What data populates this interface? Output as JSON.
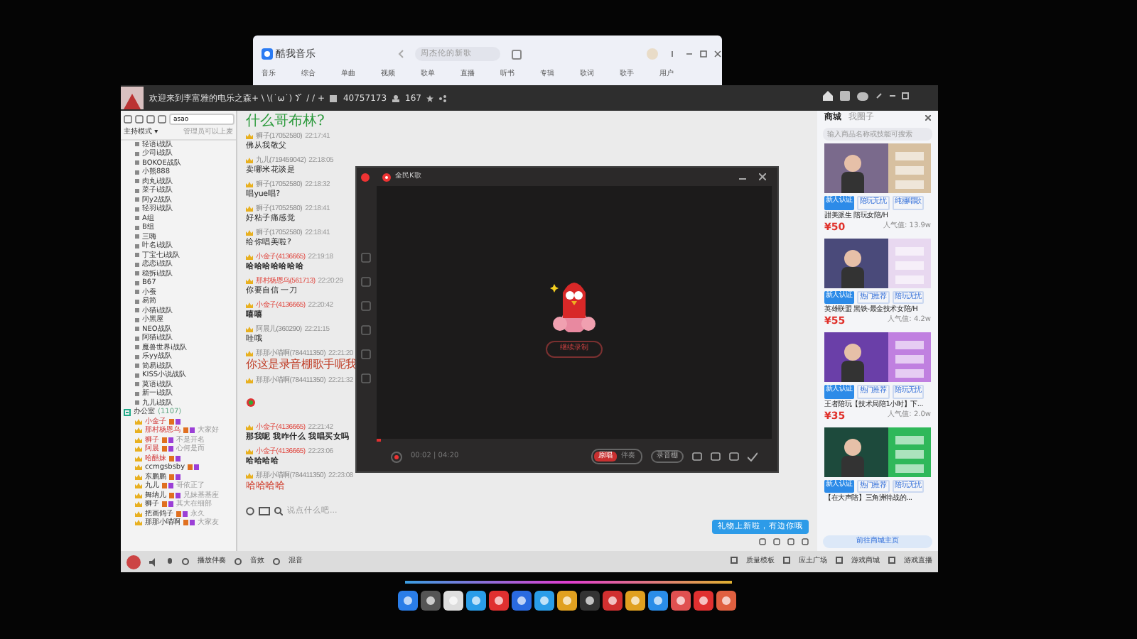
{
  "music_window": {
    "app_name": "酷我音乐",
    "search_placeholder": "周杰伦的新歌",
    "nav_item": "音乐",
    "tabs": [
      "综合",
      "单曲",
      "视频",
      "歌单",
      "直播",
      "听书",
      "专辑",
      "歌词",
      "歌手",
      "用户"
    ]
  },
  "room_window": {
    "title": "欢迎来到李富雅的电乐之森+ \\ \\(˙ω˙)",
    "title_end": "/ / +",
    "room_id": "40757173",
    "online": "167",
    "left_panel": {
      "search_value": "asao",
      "mode": "主持模式 ▾",
      "mode_hint": "管理员可以上麦",
      "channels": [
        "轻语i战队",
        "少司i战队",
        "BOKOE战队",
        "小熊888",
        "肉丸i战队",
        "菜子i战队",
        "阿y2战队",
        "轻羽i战队",
        "A组",
        "B组",
        "三嗨",
        "叶名i战队",
        "丁宝七i战队",
        "恋恋i战队",
        "稳拆i战队",
        "B67",
        "小蚕",
        "易简",
        "小猫i战队",
        "小黑屋",
        "NEO战队",
        "阿猫i战队",
        "魔兽世界i战队",
        "乐yy战队",
        "简易i战队",
        "KISS小说战队",
        "莫语i战队",
        "新一i战队",
        "九儿i战队"
      ],
      "group": {
        "name": "办公室",
        "count": "(1107)",
        "expanded": true,
        "members": [
          {
            "name": "小金子",
            "vip": true
          },
          {
            "name": "那村杨恩乌",
            "status": "大家好",
            "vip": true
          },
          {
            "name": "狮子",
            "status": "不是开名",
            "vip": true
          },
          {
            "name": "阿晨",
            "status": "心何是而",
            "vip": true
          },
          {
            "name": "哈酷妹",
            "vip": true
          },
          {
            "name": "ccmgsbsby",
            "vip": false
          },
          {
            "name": "东鹏鹏",
            "vip": false
          },
          {
            "name": "九儿",
            "status": "哥依正了",
            "vip": false
          },
          {
            "name": "舞纳儿",
            "status": "兄妹基基座",
            "vip": false
          },
          {
            "name": "狮子",
            "status": "其大在细部",
            "vip": false
          },
          {
            "name": "把画鸽子",
            "status": "永久",
            "vip": false
          },
          {
            "name": "那那小喵啊",
            "status": "大家友",
            "vip": false
          }
        ]
      }
    },
    "chat": {
      "topic": "什么哥布林?",
      "messages": [
        {
          "sender": "狮子(17052580)",
          "time": "22:17:41",
          "text": "佛从我敬父",
          "kind": "plain",
          "vip": false
        },
        {
          "sender": "九儿(719459042)",
          "time": "22:18:05",
          "text": "卖哪米花谈是",
          "kind": "plain",
          "vip": false
        },
        {
          "sender": "狮子(17052580)",
          "time": "22:18:32",
          "text": "唱yue唱?",
          "kind": "plain",
          "vip": false
        },
        {
          "sender": "狮子(17052580)",
          "time": "22:18:41",
          "text": "好粘子痛感觉",
          "kind": "plain",
          "vip": false
        },
        {
          "sender": "狮子(17052580)",
          "time": "22:18:41",
          "text": "给你唱美啦?",
          "kind": "plain",
          "vip": false
        },
        {
          "sender": "小金子(4136665)",
          "time": "22:19:18",
          "text": "哈哈哈哈哈哈哈",
          "kind": "bold",
          "vip": true
        },
        {
          "sender": "那村杨恩乌(561713)",
          "time": "22:20:29",
          "text": "你要自信 一刀",
          "kind": "plain",
          "vip": true
        },
        {
          "sender": "小金子(4136665)",
          "time": "22:20:42",
          "text": "嘻嘻",
          "kind": "bold",
          "vip": true
        },
        {
          "sender": "阿晨儿(360290)",
          "time": "22:21:15",
          "text": "哇哦",
          "kind": "plain",
          "vip": false
        },
        {
          "sender": "那那小喵啊(784411350)",
          "time": "22:21:20",
          "text": "你这是录音棚歌手呢我",
          "kind": "big-red",
          "vip": false
        },
        {
          "sender": "那那小喵啊(784411350)",
          "time": "22:21:32",
          "kind": "sticker",
          "vip": false
        },
        {
          "sender": "小金子(4136665)",
          "time": "22:21:42",
          "text": "那我呢 我咋什么 我唱买女吗",
          "kind": "bold",
          "vip": true
        },
        {
          "sender": "小金子(4136665)",
          "time": "22:23:06",
          "text": "哈哈哈哈",
          "kind": "bold",
          "vip": true
        },
        {
          "sender": "那那小喵啊(784411350)",
          "time": "22:23:08",
          "text": "哈哈哈哈",
          "kind": "red",
          "vip": false
        }
      ],
      "input_placeholder": "说点什么吧...",
      "gift_tip": "礼物上新啦，有边你哦"
    },
    "bottom_bar": {
      "left": [
        "播放伴奏",
        "音效",
        "混音"
      ],
      "right": [
        "质量模板",
        "应土广场",
        "游戏商城",
        "游戏直播"
      ]
    },
    "shop": {
      "tabs": [
        {
          "label": "商城",
          "selected": true
        },
        {
          "label": "我圈子",
          "selected": false
        }
      ],
      "search_placeholder": "输入商品名称或技能可搜索",
      "products": [
        {
          "tags": [
            "新人认证",
            "陪玩无忧",
            "纯播唱歌"
          ],
          "title": "甜美派生 陪玩女陪/H",
          "price": "¥50",
          "popularity": "人气值: 13.9w"
        },
        {
          "tags": [
            "新人认证",
            "热门推荐",
            "陪玩无忧"
          ],
          "title": "英雄联盟 黑铁-最金技术女陪/H",
          "price": "¥55",
          "popularity": "人气值: 4.2w"
        },
        {
          "tags": [
            "新人认证",
            "热门推荐",
            "陪玩无忧"
          ],
          "title": "王者陪玩【技术局陪1小时】下...",
          "price": "¥35",
          "popularity": "人气值: 2.0w"
        },
        {
          "tags": [
            "新人认证",
            "热门推荐",
            "陪玩无忧"
          ],
          "title": "【在大声陪】三角洲特战的..."
        }
      ],
      "shop_button": "前往商城主页"
    }
  },
  "recorder": {
    "title": "全民K歌",
    "continue_button": "继续录制",
    "time": "00:02 | 04:20",
    "mode_options": [
      {
        "label": "原唱",
        "selected": true
      },
      {
        "label": "伴奏",
        "selected": false
      }
    ],
    "effect_button": "录音棚",
    "progress": {
      "level": 0.01
    }
  }
}
